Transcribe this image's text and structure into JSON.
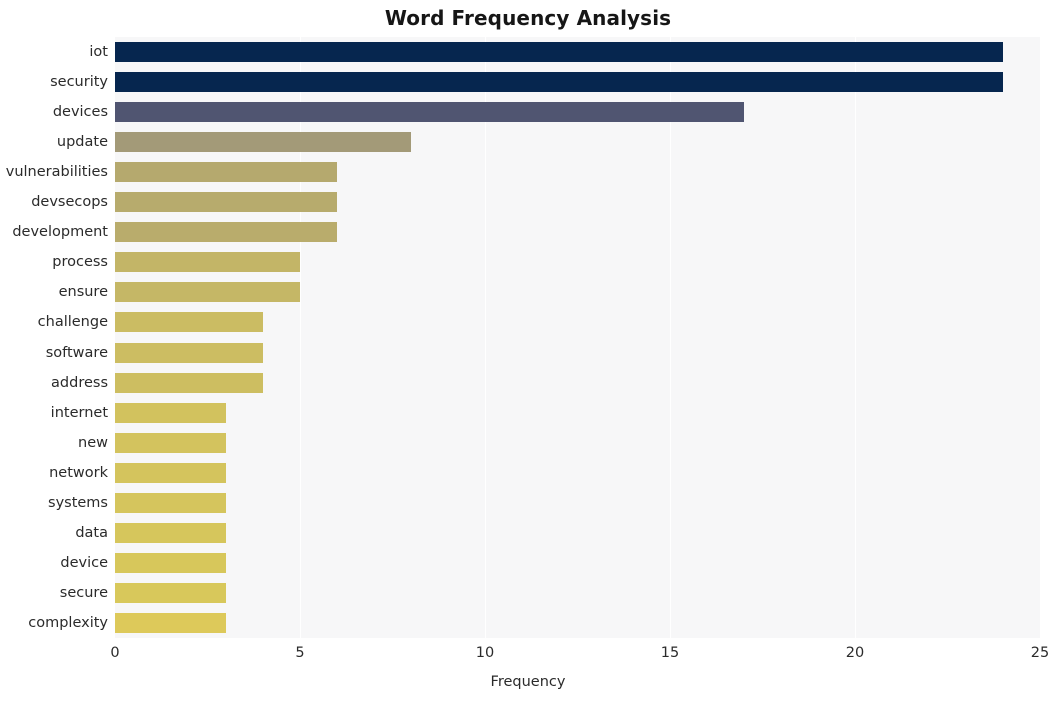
{
  "chart_data": {
    "type": "bar",
    "orientation": "horizontal",
    "title": "Word Frequency Analysis",
    "xlabel": "Frequency",
    "ylabel": "",
    "xlim": [
      0,
      25
    ],
    "xticks": [
      0,
      5,
      10,
      15,
      20,
      25
    ],
    "xtick_labels": [
      "0",
      "5",
      "10",
      "15",
      "20",
      "25"
    ],
    "grid": true,
    "legend": "none",
    "plot_bgcolor": "#f7f7f8",
    "figure_bgcolor": "#ffffff",
    "categories": [
      "iot",
      "security",
      "devices",
      "update",
      "vulnerabilities",
      "devsecops",
      "development",
      "process",
      "ensure",
      "challenge",
      "software",
      "address",
      "internet",
      "new",
      "network",
      "systems",
      "data",
      "device",
      "secure",
      "complexity"
    ],
    "values": [
      24,
      24,
      17,
      8,
      6,
      6,
      6,
      5,
      5,
      4,
      4,
      4,
      3,
      3,
      3,
      3,
      3,
      3,
      3,
      3
    ],
    "bar_colors": [
      "#06264f",
      "#06264f",
      "#505571",
      "#a39a78",
      "#b5a96e",
      "#b7ab6d",
      "#b9ac6c",
      "#c3b567",
      "#c5b766",
      "#cbbc63",
      "#ccbd62",
      "#cdbe61",
      "#d2c25e",
      "#d3c35e",
      "#d4c45d",
      "#d5c55d",
      "#d6c65c",
      "#d7c75b",
      "#d8c85b",
      "#ddc95a"
    ]
  }
}
